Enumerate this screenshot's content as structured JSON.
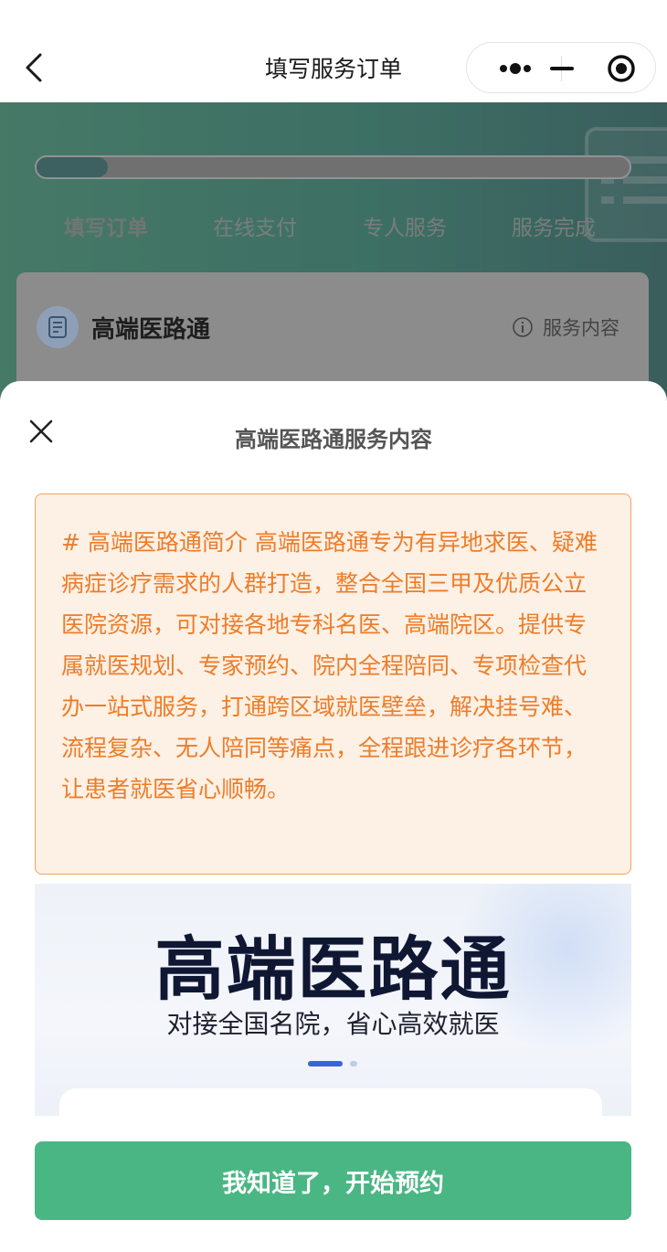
{
  "nav": {
    "title": "填写服务订单"
  },
  "progress": {
    "fraction": 0.12
  },
  "steps": [
    {
      "label": "填写订单",
      "active": true
    },
    {
      "label": "在线支付",
      "active": false
    },
    {
      "label": "专人服务",
      "active": false
    },
    {
      "label": "服务完成",
      "active": false
    }
  ],
  "service": {
    "name": "高端医路通",
    "info_label": "服务内容"
  },
  "sheet": {
    "title": "高端医路通服务内容",
    "intro": "# 高端医路通简介 高端医路通专为有异地求医、疑难病症诊疗需求的人群打造，整合全国三甲及优质公立医院资源，可对接各地专科名医、高端院区。提供专属就医规划、专家预约、院内全程陪同、专项检查代办一站式服务，打通跨区域就医壁垒，解决挂号难、流程复杂、无人陪同等痛点，全程跟进诊疗各环节，让患者就医省心顺畅。",
    "promo": {
      "title": "高端医路通",
      "subtitle": "对接全国名院，省心高效就医"
    },
    "cta_label": "我知道了，开始预约"
  },
  "colors": {
    "accent_green": "#4ab684",
    "intro_text": "#ec7d2a",
    "intro_bg": "#fdf0e4",
    "carousel_active": "#3a63d8"
  }
}
